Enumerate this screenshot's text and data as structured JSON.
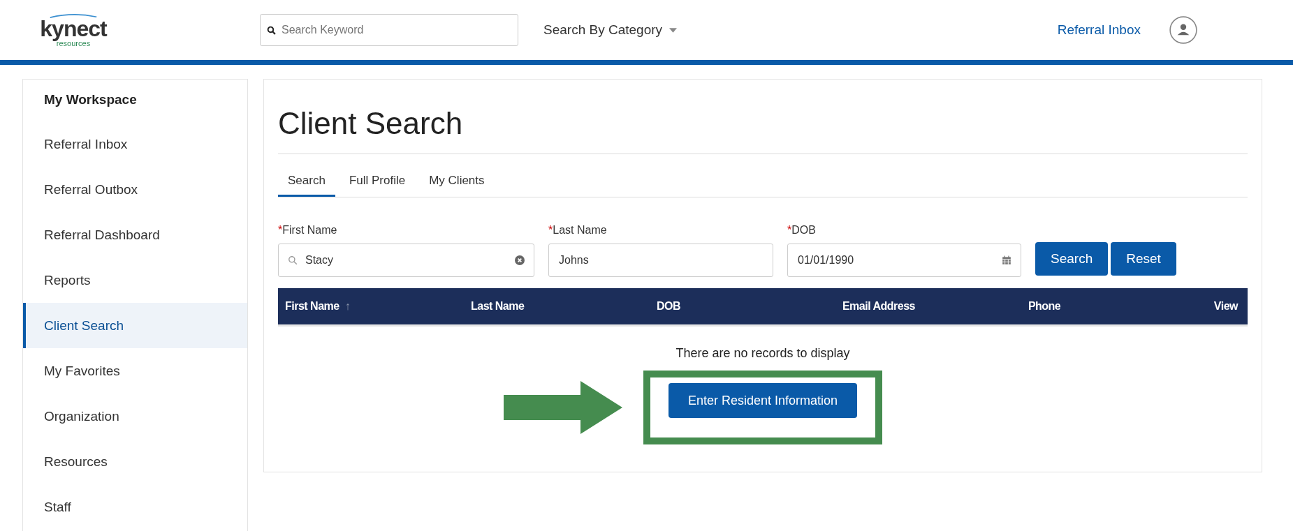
{
  "header": {
    "logo": {
      "name": "kynect",
      "sub": "resources"
    },
    "search": {
      "placeholder": "Search Keyword"
    },
    "category": "Search By Category",
    "link": "Referral Inbox"
  },
  "sidebar": {
    "title": "My Workspace",
    "items": [
      {
        "label": "Referral Inbox",
        "selected": false
      },
      {
        "label": "Referral Outbox",
        "selected": false
      },
      {
        "label": "Referral Dashboard",
        "selected": false
      },
      {
        "label": "Reports",
        "selected": false
      },
      {
        "label": "Client Search",
        "selected": true
      },
      {
        "label": "My Favorites",
        "selected": false
      },
      {
        "label": "Organization",
        "selected": false
      },
      {
        "label": "Resources",
        "selected": false
      },
      {
        "label": "Staff",
        "selected": false
      }
    ]
  },
  "main": {
    "title": "Client Search",
    "tabs": [
      {
        "label": "Search",
        "selected": true
      },
      {
        "label": "Full Profile",
        "selected": false
      },
      {
        "label": "My Clients",
        "selected": false
      }
    ],
    "fields": [
      {
        "kind": "search",
        "label": "First Name",
        "required_mark": "*",
        "value": "Stacy"
      },
      {
        "kind": "text",
        "label": "Last Name",
        "required_mark": "*",
        "value": "Johns"
      },
      {
        "kind": "date",
        "label": "DOB",
        "required_mark": "*",
        "value": "01/01/1990"
      }
    ],
    "buttons": [
      "Search",
      "Reset"
    ],
    "table": {
      "columns": [
        {
          "label": "First Name",
          "sort": "↑"
        },
        {
          "label": "Last Name"
        },
        {
          "label": "DOB"
        },
        {
          "label": "Email Address"
        },
        {
          "label": "Phone"
        },
        {
          "label": "View"
        }
      ],
      "empty": "There are no records to display"
    },
    "action": "Enter Resident Information"
  }
}
